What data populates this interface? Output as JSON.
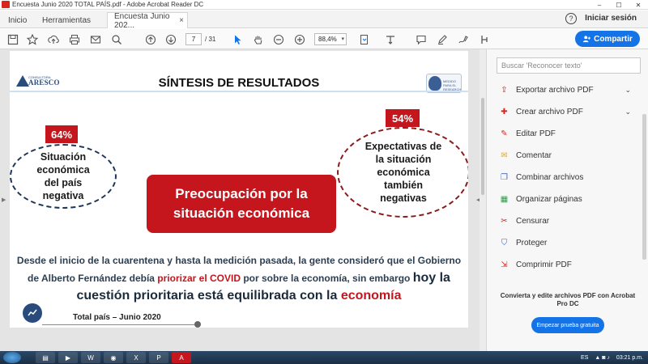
{
  "window": {
    "title": "Encuesta Junio 2020 TOTAL PAÍS.pdf - Adobe Acrobat Reader DC",
    "controls": [
      "–",
      "☐",
      "✕"
    ]
  },
  "tabs": {
    "inicio": "Inicio",
    "herramientas": "Herramientas",
    "document": "Encuesta Junio 202...",
    "close": "×"
  },
  "header": {
    "help": "?",
    "signin": "Iniciar sesión"
  },
  "toolbar": {
    "page_current": "7",
    "page_total": "/ 31",
    "zoom": "88,4%",
    "share_label": "Compartir"
  },
  "slide": {
    "title": "SÍNTESIS DE RESULTADOS",
    "logo_left_brand": "ARESCO",
    "logo_left_sub": "CONSULTORA",
    "logo_right_label": "MEDIDO\nPARA EL\nRESEARCH",
    "left_percent": "64%",
    "left_text_lines": [
      "Situación",
      "económica",
      "del país",
      "negativa"
    ],
    "right_percent": "54%",
    "right_text_lines": [
      "Expectativas de",
      "la situación",
      "económica",
      "también",
      "negativas"
    ],
    "central_lines": [
      "Preocupación por la",
      "situación económica"
    ],
    "body_line1": "Desde el inicio de la cuarentena y hasta la medición pasada, la gente consideró que  el Gobierno",
    "body_line2_a": "de Alberto Fernández debía ",
    "body_line2_red": "priorizar el COVID",
    "body_line2_b": " por sobre la economía, sin embargo ",
    "body_line2_big": "hoy la",
    "body_line3_a": "cuestión prioritaria está equilibrada con la ",
    "body_line3_red": "economía",
    "footer": "Total país – Junio 2020"
  },
  "right_panel": {
    "search_placeholder": "Buscar 'Reconocer texto'",
    "items": [
      {
        "label": "Exportar archivo PDF",
        "icon": "export-pdf-icon",
        "chevron": true,
        "color": "#d9261c"
      },
      {
        "label": "Crear archivo PDF",
        "icon": "create-pdf-icon",
        "chevron": true,
        "color": "#d9261c"
      },
      {
        "label": "Editar PDF",
        "icon": "edit-pdf-icon",
        "chevron": false,
        "color": "#d9261c"
      },
      {
        "label": "Comentar",
        "icon": "comment-icon",
        "chevron": false,
        "color": "#e8a91c"
      },
      {
        "label": "Combinar archivos",
        "icon": "combine-icon",
        "chevron": false,
        "color": "#3b64c8"
      },
      {
        "label": "Organizar páginas",
        "icon": "organize-icon",
        "chevron": false,
        "color": "#2a9d4a"
      },
      {
        "label": "Censurar",
        "icon": "redact-icon",
        "chevron": false,
        "color": "#d9261c"
      },
      {
        "label": "Proteger",
        "icon": "protect-icon",
        "chevron": false,
        "color": "#3b64c8"
      },
      {
        "label": "Comprimir PDF",
        "icon": "compress-icon",
        "chevron": false,
        "color": "#d9261c"
      }
    ],
    "promo": "Convierta y edite archivos PDF con Acrobat Pro DC",
    "promo_button": "Empezar prueba gratuita"
  },
  "taskbar": {
    "lang": "ES",
    "time": "03:21 p.m."
  }
}
